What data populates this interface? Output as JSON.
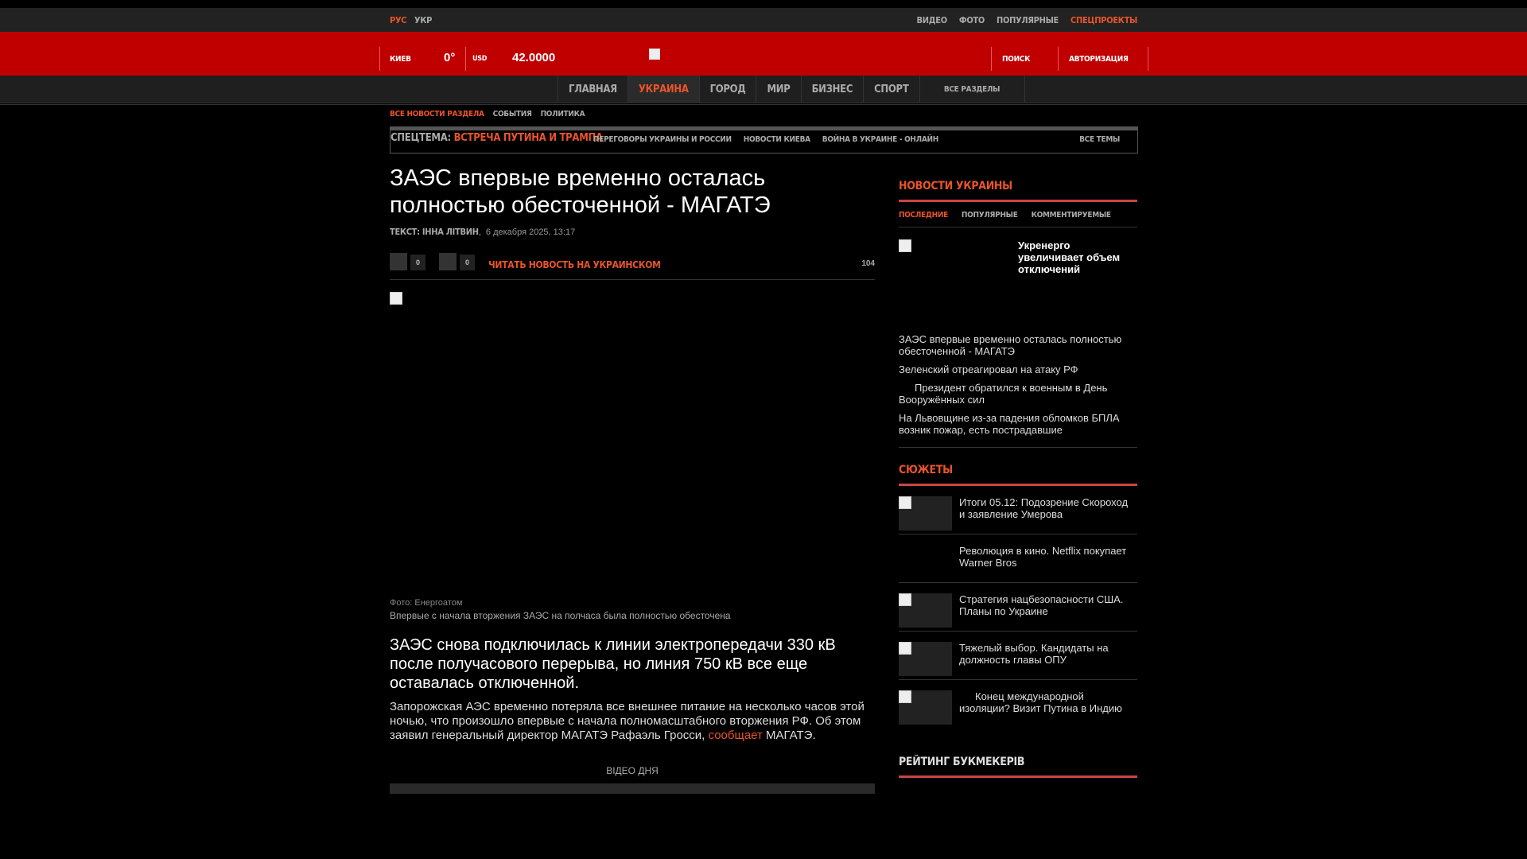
{
  "topbar": {
    "lang_ru": "РУС",
    "lang_ua": "УКР",
    "links": [
      "ВИДЕО",
      "ФОТО",
      "ПОПУЛЯРНЫЕ"
    ],
    "special": "СПЕЦПРОЕКТЫ"
  },
  "header": {
    "city": "КИЕВ",
    "temp": "0°",
    "currency": "USD",
    "rate": "42.0000",
    "search": "ПОИСК",
    "auth": "АВТОРИЗАЦИЯ"
  },
  "menu": {
    "items": [
      "ГЛАВНАЯ",
      "УКРАИНА",
      "ГОРОД",
      "МИР",
      "БИЗНЕС",
      "СПОРТ"
    ],
    "all": "ВСЕ РАЗДЕЛЫ"
  },
  "submenu": {
    "items": [
      "ВСЕ НОВОСТИ РАЗДЕЛА",
      "СОБЫТИЯ",
      "ПОЛИТИКА"
    ]
  },
  "spec": {
    "label": "СПЕЦТЕМА:",
    "topic": "ВСТРЕЧА ПУТИНА И ТРАМПА",
    "links": [
      "ПЕРЕГОВОРЫ УКРАИНЫ И РОССИИ",
      "НОВОСТИ КИЕВА",
      "ВОЙНА В УКРАИНЕ - ОНЛАЙН"
    ],
    "all": "ВСЕ ТЕМЫ"
  },
  "article": {
    "title": "ЗАЭС впервые временно осталась полностью обесточенной - МАГАТЭ",
    "author_label": "ТЕКСТ: ІННА ЛІТВИН",
    "date": "6 декабря 2025, 13:17",
    "count1": "0",
    "count2": "0",
    "read_ukr": "ЧИТАТЬ НОВОСТЬ НА УКРАИНСКОМ",
    "views": "104",
    "photo_credit": "Фото: Енергоатом",
    "photo_caption": "Впервые с начала вторжения ЗАЭС на полчаса была полностью обесточена",
    "lead": "ЗАЭС снова подключилась к линии электропередачи 330 кВ после получасового перерыва, но линия 750 кВ все еще оставалась отключенной.",
    "body_before": "Запорожская АЭС временно потеряла все внешнее питание на несколько часов этой ночью, что произошло впервые с начала полномасштабного вторжения РФ. Об этом заявил генеральный директор МАГАТЭ Рафаэль Гросси, ",
    "body_link": "сообщает",
    "body_after": " МАГАТЭ.",
    "video_label": "ВІДЕО ДНЯ"
  },
  "sidebar": {
    "news_title": "НОВОСТИ УКРАИНЫ",
    "tabs": [
      "ПОСЛЕДНИЕ",
      "ПОПУЛЯРНЫЕ",
      "КОММЕНТИРУЕМЫЕ"
    ],
    "featured": "Укренерго увеличивает объем отключений",
    "news": [
      "ЗАЭС впервые временно осталась полностью обесточенной - МАГАТЭ",
      "Зеленский отреагировал на атаку РФ",
      "Президент обратился к военным в День Вооружённых сил",
      "На Львовщине из-за падения обломков БПЛА возник пожар, есть пострадавшие"
    ],
    "stories_title": "СЮЖЕТЫ",
    "stories": [
      "Итоги 05.12: Подозрение Скороход и заявление Умерова",
      "Революция в кино. Netflix покупает Warner Bros",
      "Стратегия нацбезопасности США. Планы по Украине",
      "Тяжелый выбор. Кандидаты на должность главы ОПУ",
      "Конец международной изоляции? Визит Путина в Индию"
    ],
    "bookmakers_title": "РЕЙТИНГ БУКМЕКЕРІВ"
  },
  "colors": {
    "accent": "#e8542a",
    "header_red": "#c00000",
    "background": "#000000"
  }
}
